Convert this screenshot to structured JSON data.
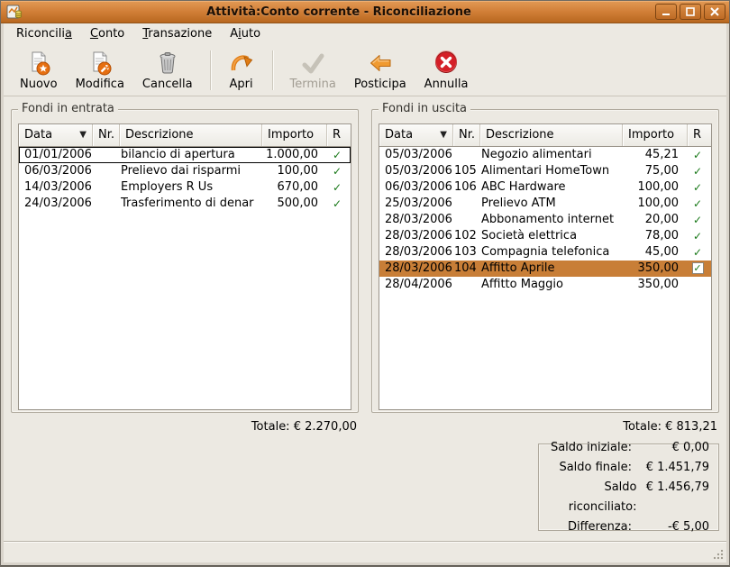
{
  "window": {
    "title": "Attività:Conto corrente - Riconciliazione"
  },
  "menu": {
    "items": [
      {
        "pre": "Riconcili",
        "key": "a",
        "post": ""
      },
      {
        "pre": "",
        "key": "C",
        "post": "onto"
      },
      {
        "pre": "",
        "key": "T",
        "post": "ransazione"
      },
      {
        "pre": "A",
        "key": "i",
        "post": "uto"
      }
    ]
  },
  "toolbar": {
    "buttons": [
      {
        "label": "Nuovo",
        "enabled": true
      },
      {
        "label": "Modifica",
        "enabled": true
      },
      {
        "label": "Cancella",
        "enabled": true
      },
      {
        "label": "Apri",
        "enabled": true
      },
      {
        "label": "Termina",
        "enabled": false
      },
      {
        "label": "Posticipa",
        "enabled": true
      },
      {
        "label": "Annulla",
        "enabled": true
      }
    ]
  },
  "left_panel": {
    "legend": "Fondi in entrata",
    "columns": [
      "Data",
      "Nr.",
      "Descrizione",
      "Importo",
      "R"
    ],
    "rows": [
      {
        "date": "01/01/2006",
        "nr": "",
        "desc": "bilancio di apertura",
        "amount": "1.000,00",
        "checked": true,
        "focused": true,
        "selected": false
      },
      {
        "date": "06/03/2006",
        "nr": "",
        "desc": "Prelievo dai risparmi",
        "amount": "100,00",
        "checked": true,
        "focused": false,
        "selected": false
      },
      {
        "date": "14/03/2006",
        "nr": "",
        "desc": "Employers R Us",
        "amount": "670,00",
        "checked": true,
        "focused": false,
        "selected": false
      },
      {
        "date": "24/03/2006",
        "nr": "",
        "desc": "Trasferimento di denar",
        "amount": "500,00",
        "checked": true,
        "focused": false,
        "selected": false
      }
    ],
    "total": "Totale: € 2.270,00"
  },
  "right_panel": {
    "legend": "Fondi in uscita",
    "columns": [
      "Data",
      "Nr.",
      "Descrizione",
      "Importo",
      "R"
    ],
    "rows": [
      {
        "date": "05/03/2006",
        "nr": "",
        "desc": "Negozio alimentari",
        "amount": "45,21",
        "checked": true,
        "focused": false,
        "selected": false
      },
      {
        "date": "05/03/2006",
        "nr": "105",
        "desc": "Alimentari HomeTown",
        "amount": "75,00",
        "checked": true,
        "focused": false,
        "selected": false
      },
      {
        "date": "06/03/2006",
        "nr": "106",
        "desc": "ABC Hardware",
        "amount": "100,00",
        "checked": true,
        "focused": false,
        "selected": false
      },
      {
        "date": "25/03/2006",
        "nr": "",
        "desc": "Prelievo ATM",
        "amount": "100,00",
        "checked": true,
        "focused": false,
        "selected": false
      },
      {
        "date": "28/03/2006",
        "nr": "",
        "desc": "Abbonamento internet",
        "amount": "20,00",
        "checked": true,
        "focused": false,
        "selected": false
      },
      {
        "date": "28/03/2006",
        "nr": "102",
        "desc": "Società elettrica",
        "amount": "78,00",
        "checked": true,
        "focused": false,
        "selected": false
      },
      {
        "date": "28/03/2006",
        "nr": "103",
        "desc": "Compagnia telefonica",
        "amount": "45,00",
        "checked": true,
        "focused": false,
        "selected": false
      },
      {
        "date": "28/03/2006",
        "nr": "104",
        "desc": "Affitto Aprile",
        "amount": "350,00",
        "checked": true,
        "focused": false,
        "selected": true
      },
      {
        "date": "28/04/2006",
        "nr": "",
        "desc": "Affitto Maggio",
        "amount": "350,00",
        "checked": false,
        "focused": false,
        "selected": false
      }
    ],
    "total": "Totale: € 813,21"
  },
  "summary": {
    "rows": [
      {
        "label": "Saldo iniziale:",
        "value": "€ 0,00"
      },
      {
        "label": "Saldo finale:",
        "value": "€ 1.451,79"
      },
      {
        "label": "Saldo riconciliato:",
        "value": "€ 1.456,79"
      },
      {
        "label": "Differenza:",
        "value": "-€ 5,00"
      }
    ]
  }
}
